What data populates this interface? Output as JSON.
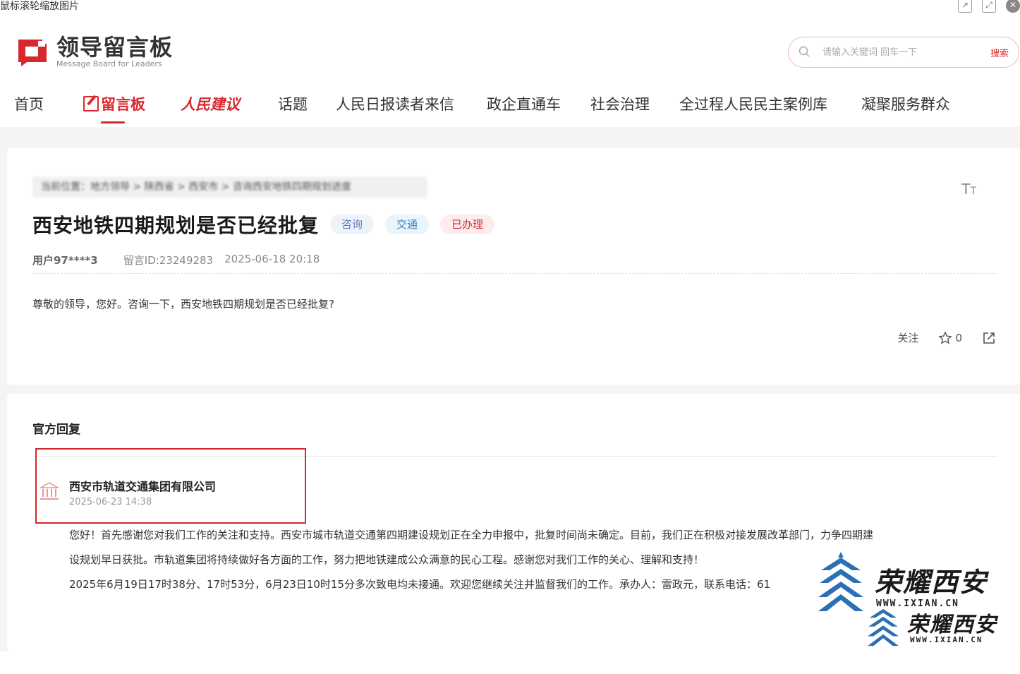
{
  "window": {
    "hint_text": "鼠标滚轮缩放图片",
    "icons": [
      "open-external-icon",
      "expand-icon",
      "close-icon"
    ]
  },
  "header": {
    "logo_title": "领导留言板",
    "logo_subtitle": "Message Board for Leaders",
    "search_placeholder": "请输入关键词 回车一下",
    "search_button": "搜索"
  },
  "nav": {
    "items": [
      {
        "label": "首页"
      },
      {
        "label": "留言板"
      },
      {
        "label": "人民建议"
      },
      {
        "label": "话题"
      },
      {
        "label": "人民日报读者来信"
      },
      {
        "label": "政企直通车"
      },
      {
        "label": "社会治理"
      },
      {
        "label": "全过程人民民主案例库"
      },
      {
        "label": "凝聚服务群众"
      }
    ]
  },
  "message": {
    "breadcrumb": "当前位置：地方领导 > 陕西省 > 西安市 > 咨询西安地铁四期规划进度",
    "title": "西安地铁四期规划是否已经批复",
    "tags": [
      "咨询",
      "交通",
      "已办理"
    ],
    "user": "用户97****3",
    "message_id": "留言ID:23249283",
    "datetime": "2025-06-18 20:18",
    "content": "尊敬的领导，您好。咨询一下，西安地铁四期规划是否已经批复?",
    "follow_label": "关注",
    "like_count": "0"
  },
  "reply": {
    "section_title": "官方回复",
    "org_name": "西安市轨道交通集团有限公司",
    "org_date": "2025-06-23 14:38",
    "body_line1": "您好！首先感谢您对我们工作的关注和支持。西安市城市轨道交通第四期建设规划正在全力申报中，批复时间尚未确定。目前，我们正在积极对接发展改革部门，力争四期建",
    "body_line2": "设规划早日获批。市轨道集团将持续做好各方面的工作，努力把地铁建成公众满意的民心工程。感谢您对我们工作的关心、理解和支持！",
    "body_line3": "2025年6月19日17时38分、17时53分，6月23日10时15分多次致电均未接通。欢迎您继续关注并监督我们的工作。承办人：雷政元，联系电话：61"
  },
  "watermark": {
    "text": "荣耀西安",
    "url": "WWW.IXIAN.CN"
  },
  "colors": {
    "brand_red": "#d7282e",
    "watermark_blue": "#2b6fb5"
  }
}
